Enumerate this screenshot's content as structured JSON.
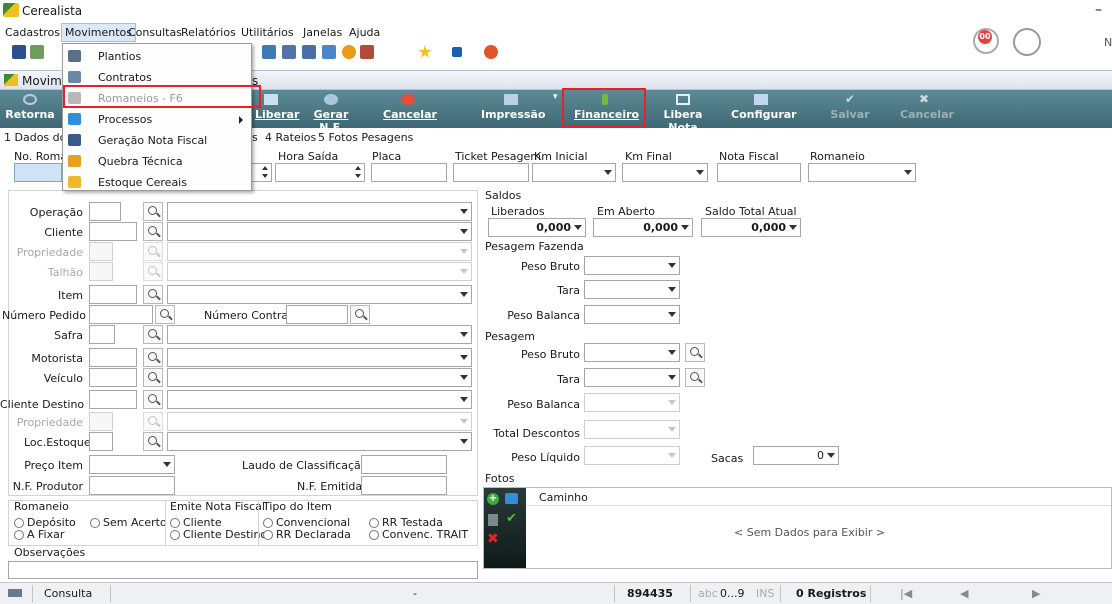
{
  "app_title": "Cerealista",
  "menubar": {
    "cadastros": "Cadastros",
    "movimentos": "Movimentos",
    "consultas": "Consultas",
    "relatorios": "Relatórios",
    "utilitarios": "Utilitários",
    "janelas": "Janelas",
    "ajuda": "Ajuda"
  },
  "notification_badge": "00",
  "window_title": "Movim",
  "window_title_tail": "s",
  "dropdown": {
    "items": [
      {
        "label": "Plantios"
      },
      {
        "label": "Contratos"
      },
      {
        "label": "Romaneios - F6"
      },
      {
        "label": "Processos"
      },
      {
        "label": "Geração Nota Fiscal"
      },
      {
        "label": "Quebra Técnica"
      },
      {
        "label": "Estoque Cereais"
      }
    ]
  },
  "commands": {
    "retornar": "Retorna",
    "liberar": "Liberar",
    "gerar_nf": "Gerar N.F.",
    "cancelar": "Cancelar",
    "impressao": "Impressão",
    "financeiro": "Financeiro",
    "libera_nota": "Libera Nota",
    "configurar": "Configurar",
    "salvar": "Salvar",
    "cancelar2": "Cancelar"
  },
  "tabs": {
    "dados": "1 Dados do",
    "tab3_tail": "s",
    "rateios": "4 Rateios",
    "fotos": "5 Fotos Pesagens"
  },
  "header_fields": {
    "no_romaneio": "No. Romar",
    "hora_saida": "Hora Saída",
    "placa": "Placa",
    "ticket_pesagem": "Ticket Pesagem",
    "km_inicial": "Km Inicial",
    "km_final": "Km Final",
    "nota_fiscal": "Nota Fiscal",
    "romaneio": "Romaneio"
  },
  "form": {
    "operacao": "Operação",
    "cliente": "Cliente",
    "propriedade": "Propriedade",
    "talhao": "Talhão",
    "item": "Item",
    "numero_pedido": "Número Pedido",
    "numero_contrato": "Número Contrato",
    "safra": "Safra",
    "motorista": "Motorista",
    "veiculo": "Veículo",
    "cliente_destino": "Cliente Destino",
    "propriedade2": "Propriedade",
    "loc_estoque": "Loc.Estoque",
    "preco_item": "Preço Item",
    "laudo": "Laudo de Classificação",
    "nf_produtor": "N.F. Produtor",
    "nf_emitida": "N.F. Emitida"
  },
  "radio_groups": {
    "romaneio_title": "Romaneio",
    "deposito": "Depósito",
    "sem_acerto": "Sem Acerto",
    "a_fixar": "A Fixar",
    "emite_title": "Emite Nota Fiscal",
    "cliente": "Cliente",
    "cliente_destino": "Cliente Destino",
    "tipo_title": "Tipo do Item",
    "convencional": "Convencional",
    "rr_declarada": "RR Declarada",
    "rr_testada": "RR Testada",
    "convenc_trait": "Convenc. TRAIT"
  },
  "observacoes": "Observações",
  "saldos": {
    "title": "Saldos",
    "liberados": "Liberados",
    "em_aberto": "Em Aberto",
    "saldo_total": "Saldo Total Atual",
    "liberados_val": "0,000",
    "em_aberto_val": "0,000",
    "saldo_total_val": "0,000"
  },
  "pesagem_fazenda": {
    "title": "Pesagem Fazenda",
    "peso_bruto": "Peso Bruto",
    "tara": "Tara",
    "peso_balanca": "Peso Balanca"
  },
  "pesagem": {
    "title": "Pesagem",
    "peso_bruto": "Peso Bruto",
    "tara": "Tara",
    "peso_balanca": "Peso Balanca",
    "total_descontos": "Total Descontos",
    "peso_liquido": "Peso Líquido",
    "sacas": "Sacas",
    "sacas_val": "0"
  },
  "fotos": {
    "title": "Fotos",
    "caminho": "Caminho",
    "empty": "< Sem Dados para Exibir >"
  },
  "status": {
    "consulta": "Consulta",
    "dash": "-",
    "id": "894435",
    "abc": "abc",
    "digits": "0...9",
    "ins": "INS",
    "registros": "0 Registros"
  },
  "colors": {
    "cmdbar": "#4b7683",
    "highlight_box": "#e8202a"
  }
}
